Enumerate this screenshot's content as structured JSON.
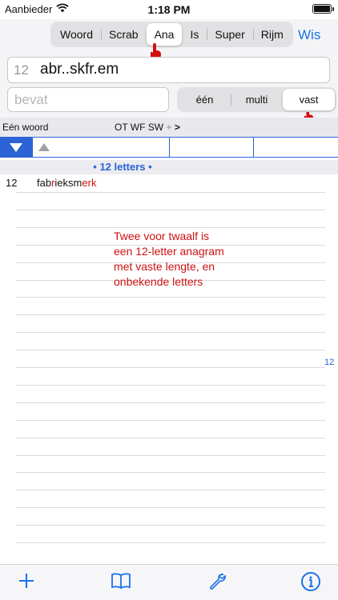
{
  "status": {
    "carrier": "Aanbieder",
    "time": "1:18 PM"
  },
  "modes": [
    "Woord",
    "Scrab",
    "Ana",
    "Is",
    "Super",
    "Rijm"
  ],
  "selected_mode": "Ana",
  "wis_label": "Wis",
  "search": {
    "letter_count": "12",
    "pattern": "abr..skfr.em"
  },
  "bevat": {
    "placeholder": "bevat"
  },
  "filters": [
    "één",
    "multi",
    "vast"
  ],
  "selected_filter": "vast",
  "columns": {
    "label": "Eén woord",
    "sorts": "OT  WF  SW",
    "more": "+",
    "chevron": ">"
  },
  "group": {
    "title": "• 12 letters •"
  },
  "results": [
    {
      "length": "12",
      "word_parts": [
        "fab",
        "r",
        "ieksm",
        "e",
        "rk"
      ],
      "red_flags": [
        false,
        true,
        false,
        true,
        true
      ]
    }
  ],
  "annotation": [
    "Twee voor twaalf is",
    "een 12-letter anagram",
    "met vaste lengte, en",
    "onbekende letters"
  ],
  "side_count": "12",
  "tabbar": {
    "icons": [
      "plus-icon",
      "book-icon",
      "wrench-icon",
      "info-icon"
    ]
  },
  "colors": {
    "accent": "#1a73e8",
    "sort_blue": "#2b63d6",
    "highlight_red": "#d21010"
  }
}
